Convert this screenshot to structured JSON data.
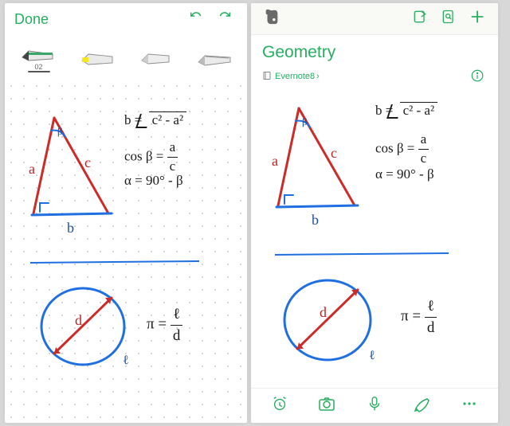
{
  "accent": "#27ae60",
  "left": {
    "done_label": "Done",
    "active_tool_label": "02",
    "tools": [
      "pencil",
      "highlighter",
      "eraser",
      "cutter"
    ]
  },
  "right": {
    "title": "Geometry",
    "notebook": "Evernote8"
  },
  "sketch": {
    "triangle": {
      "sides": {
        "a_label": "a",
        "b_label": "b",
        "c_label": "c"
      },
      "angle_label": "β",
      "eq1_lhs": "b =",
      "eq1_rad": "c² - a²",
      "eq2_lhs": "cos β =",
      "eq2_num": "a",
      "eq2_den": "c",
      "eq3": "α = 90° - β"
    },
    "circle": {
      "diam_label": "d",
      "perim_label": "ℓ",
      "eq_lhs": "π =",
      "eq_num": "ℓ",
      "eq_den": "d"
    }
  }
}
